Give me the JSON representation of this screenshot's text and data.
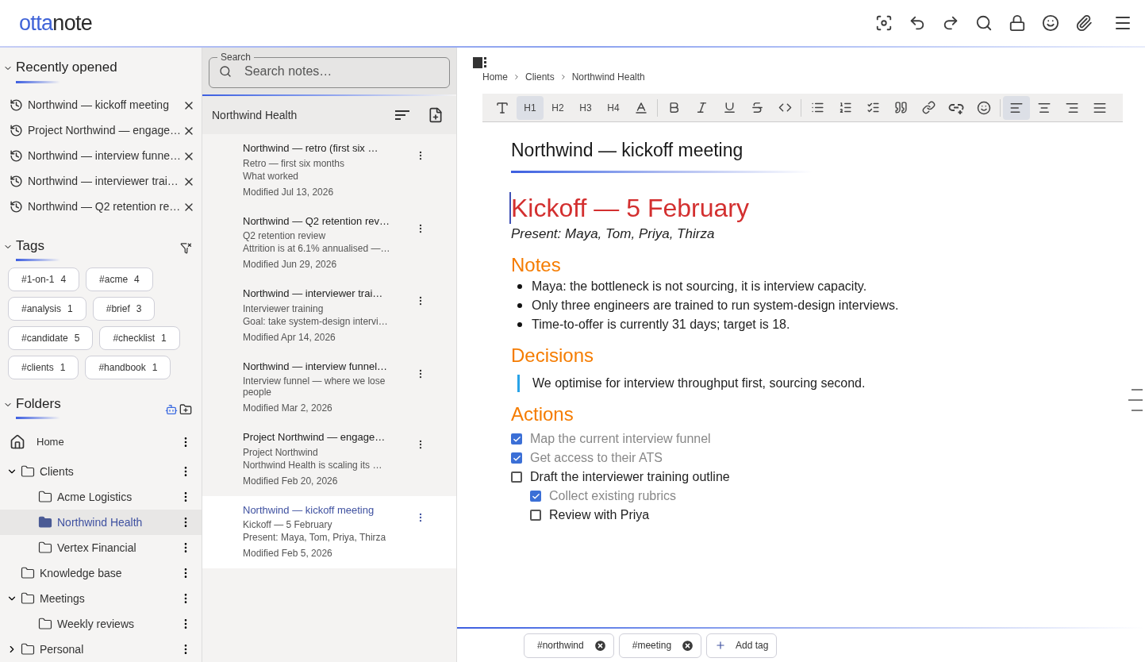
{
  "logo": [
    {
      "text": "otta",
      "accent": true
    },
    {
      "text": "note",
      "accent": false
    }
  ],
  "recent": {
    "title": "Recently opened",
    "expanded": true,
    "items": [
      {
        "label": "Northwind — kickoff meeting"
      },
      {
        "label": "Project Northwind — engage…"
      },
      {
        "label": "Northwind — interview funne…"
      },
      {
        "label": "Northwind — interviewer trai…"
      },
      {
        "label": "Northwind — Q2 retention re…"
      }
    ]
  },
  "tags": {
    "title": "Tags",
    "expanded": true,
    "items": [
      {
        "name": "#1-on-1",
        "count": "4"
      },
      {
        "name": "#acme",
        "count": "4"
      },
      {
        "name": "#analysis",
        "count": "1"
      },
      {
        "name": "#brief",
        "count": "3"
      },
      {
        "name": "#candidate",
        "count": "5"
      },
      {
        "name": "#checklist",
        "count": "1"
      },
      {
        "name": "#clients",
        "count": "1"
      },
      {
        "name": "#handbook",
        "count": "1"
      }
    ]
  },
  "folders": {
    "title": "Folders",
    "expanded": true,
    "home": {
      "label": "Home"
    },
    "items": [
      {
        "label": "Clients",
        "expanded": true,
        "selected": false,
        "children": [
          {
            "label": "Acme Logistics",
            "selected": false
          },
          {
            "label": "Northwind Health",
            "selected": true
          },
          {
            "label": "Vertex Financial",
            "selected": false
          }
        ]
      },
      {
        "label": "Knowledge base",
        "selected": false
      },
      {
        "label": "Meetings",
        "expanded": true,
        "selected": false,
        "children": [
          {
            "label": "Weekly reviews",
            "selected": false
          }
        ]
      },
      {
        "label": "Personal",
        "expanded": false,
        "selected": false
      }
    ]
  },
  "search": {
    "label": "Search",
    "placeholder": "Search notes…"
  },
  "notes": {
    "folder": "Northwind Health",
    "items": [
      {
        "title": "Northwind — retro (first six …",
        "lines": [
          "Retro — first six months",
          "What worked"
        ],
        "modified": "Modified Jul 13, 2026",
        "selected": false
      },
      {
        "title": "Northwind — Q2 retention rev…",
        "lines": [
          "Q2 retention review",
          "Attrition is at 6.1% annualised —…"
        ],
        "modified": "Modified Jun 29, 2026",
        "selected": false
      },
      {
        "title": "Northwind — interviewer trai…",
        "lines": [
          "Interviewer training",
          "Goal: take system-design intervi…"
        ],
        "modified": "Modified Apr 14, 2026",
        "selected": false
      },
      {
        "title": "Northwind — interview funnel…",
        "lines": [
          "Interview funnel — where we lose people"
        ],
        "modified": "Modified Mar 2, 2026",
        "selected": false
      },
      {
        "title": "Project Northwind — engage…",
        "lines": [
          "Project Northwind",
          "Northwind Health is scaling its …"
        ],
        "modified": "Modified Feb 20, 2026",
        "selected": false
      },
      {
        "title": "Northwind — kickoff meeting",
        "lines": [
          "Kickoff — 5 February",
          "Present: Maya, Tom, Priya, Thirza"
        ],
        "modified": "Modified Feb 5, 2026",
        "selected": true
      }
    ]
  },
  "breadcrumb": [
    "Home",
    "Clients",
    "Northwind Health"
  ],
  "toolbar": {
    "headings": [
      {
        "label": "H1",
        "selected": true
      },
      {
        "label": "H2",
        "selected": false
      },
      {
        "label": "H3",
        "selected": false
      },
      {
        "label": "H4",
        "selected": false
      }
    ],
    "align": [
      {
        "selected": true
      },
      {
        "selected": false
      },
      {
        "selected": false
      },
      {
        "selected": false
      }
    ]
  },
  "note_title": "Northwind — kickoff meeting",
  "blocks": [
    {
      "kind": "h1",
      "text": "Kickoff — 5 February"
    },
    {
      "kind": "italic",
      "text": "Present: Maya, Tom, Priya, Thirza"
    },
    {
      "kind": "h2",
      "text": "Notes"
    },
    {
      "kind": "bullets",
      "items": [
        "Maya: the bottleneck is not sourcing, it is interview capacity.",
        "Only three engineers are trained to run system-design interviews.",
        "Time-to-offer is currently 31 days; target is 18."
      ]
    },
    {
      "kind": "h2",
      "text": "Decisions"
    },
    {
      "kind": "quote",
      "text": "We optimise for interview throughput first, sourcing second."
    },
    {
      "kind": "h2",
      "text": "Actions"
    },
    {
      "kind": "tasks",
      "items": [
        {
          "text": "Map the current interview funnel",
          "checked": true
        },
        {
          "text": "Get access to their ATS",
          "checked": true
        },
        {
          "text": "Draft the interviewer training outline",
          "checked": false,
          "children": [
            {
              "text": "Collect existing rubrics",
              "checked": true
            },
            {
              "text": "Review with Priya",
              "checked": false
            }
          ]
        }
      ]
    }
  ],
  "note_tags": [
    "#northwind",
    "#meeting"
  ],
  "add_tag": "Add tag"
}
